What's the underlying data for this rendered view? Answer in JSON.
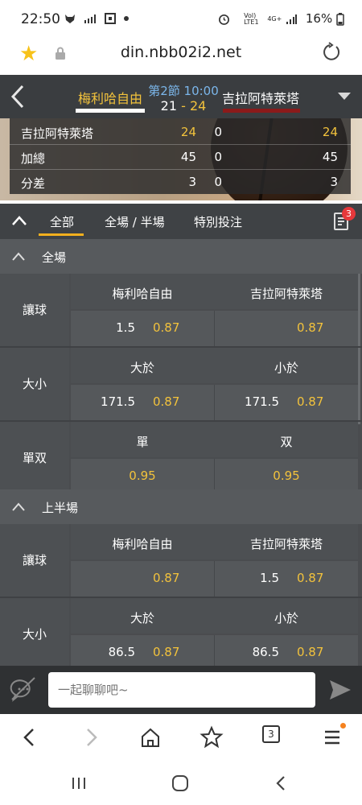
{
  "status_bar": {
    "time": "22:50",
    "network_label_top": "Vol)",
    "network_label_bottom": "LTE1",
    "network_type": "4G+",
    "battery": "16%"
  },
  "browser": {
    "url": "din.nbb02i2.net"
  },
  "match": {
    "home_team": "梅利哈自由",
    "away_team": "吉拉阿特萊塔",
    "period": "第2節 10:00",
    "home_score": "21",
    "score_separator": "-",
    "away_score": "24",
    "home_color": "#ffffff",
    "away_color": "#8b1a1a"
  },
  "scoreboard": {
    "rows": [
      {
        "label": "吉拉阿特萊塔",
        "v1": "24",
        "v2": "0",
        "v3": "24"
      },
      {
        "label": "加總",
        "v1": "45",
        "v2": "0",
        "v3": "45"
      },
      {
        "label": "分差",
        "v1": "3",
        "v2": "0",
        "v3": "3"
      }
    ]
  },
  "tabs": {
    "items": [
      {
        "label": "全部"
      },
      {
        "label": "全場 / 半場"
      },
      {
        "label": "特別投注"
      }
    ],
    "active_index": 0,
    "bet_slip_count": "3"
  },
  "sections": [
    {
      "title": "全場",
      "markets": [
        {
          "label": "讓球",
          "headers": [
            "梅利哈自由",
            "吉拉阿特萊塔"
          ],
          "cells": [
            {
              "line": "1.5",
              "odds": "0.87"
            },
            {
              "line": "",
              "odds": "0.87"
            }
          ]
        },
        {
          "label": "大小",
          "headers": [
            "大於",
            "小於"
          ],
          "cells": [
            {
              "line": "171.5",
              "odds": "0.87"
            },
            {
              "line": "171.5",
              "odds": "0.87"
            }
          ]
        },
        {
          "label": "單双",
          "headers": [
            "單",
            "双"
          ],
          "cells": [
            {
              "line": "",
              "odds": "0.95"
            },
            {
              "line": "",
              "odds": "0.95"
            }
          ]
        }
      ]
    },
    {
      "title": "上半場",
      "markets": [
        {
          "label": "讓球",
          "headers": [
            "梅利哈自由",
            "吉拉阿特萊塔"
          ],
          "cells": [
            {
              "line": "",
              "odds": "0.87"
            },
            {
              "line": "1.5",
              "odds": "0.87"
            }
          ]
        },
        {
          "label": "大小",
          "headers": [
            "大於",
            "小於"
          ],
          "cells": [
            {
              "line": "86.5",
              "odds": "0.87"
            },
            {
              "line": "86.5",
              "odds": "0.87"
            }
          ]
        }
      ]
    }
  ],
  "chat": {
    "placeholder": "一起聊聊吧~"
  },
  "browser_toolbar": {
    "tab_count": "3"
  },
  "colors": {
    "accent": "#f2b01e",
    "odds": "#f2c23c",
    "badge": "#e5383b"
  }
}
